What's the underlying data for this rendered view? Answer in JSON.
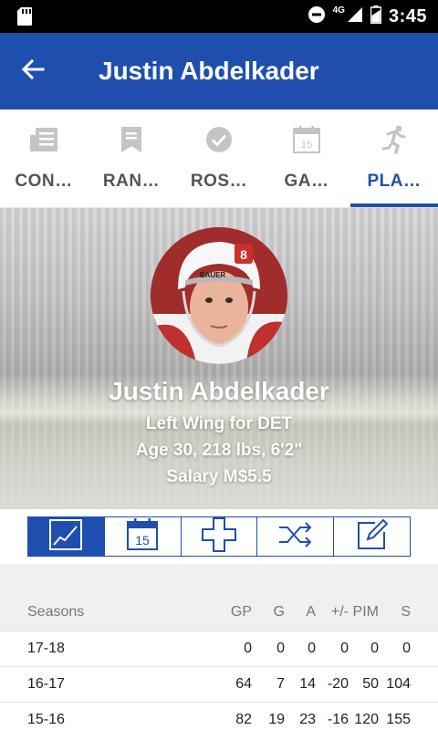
{
  "status_bar": {
    "network": "4G",
    "time": "3:45"
  },
  "app_bar": {
    "title": "Justin Abdelkader",
    "back_icon": "arrow-back-icon"
  },
  "tabs": [
    {
      "label": "CON…",
      "icon": "news-icon",
      "active": false
    },
    {
      "label": "RAN…",
      "icon": "bookmark-icon",
      "active": false
    },
    {
      "label": "ROS…",
      "icon": "check-circle-icon",
      "active": false
    },
    {
      "label": "GA…",
      "icon": "calendar-icon",
      "active": false
    },
    {
      "label": "PLA…",
      "icon": "runner-icon",
      "active": true
    }
  ],
  "calendar_day": "15",
  "player": {
    "name": "Justin Abdelkader",
    "position_team": "Left Wing for DET",
    "bio": "Age 30, 218 lbs, 6'2\"",
    "salary": "Salary M$5.5",
    "jersey_number": "8",
    "helmet_brand": "BAUER"
  },
  "view_toggle": [
    {
      "name": "chart",
      "icon": "line-chart-icon",
      "active": true
    },
    {
      "name": "schedule",
      "icon": "calendar-icon",
      "day": "15",
      "active": false
    },
    {
      "name": "health",
      "icon": "plus-icon",
      "active": false
    },
    {
      "name": "transactions",
      "icon": "shuffle-icon",
      "active": false
    },
    {
      "name": "notes",
      "icon": "edit-icon",
      "active": false
    }
  ],
  "stats": {
    "columns": [
      "Seasons",
      "GP",
      "G",
      "A",
      "+/-",
      "PIM",
      "S"
    ],
    "rows": [
      [
        "17-18",
        "0",
        "0",
        "0",
        "0",
        "0",
        "0"
      ],
      [
        "16-17",
        "64",
        "7",
        "14",
        "-20",
        "50",
        "104"
      ],
      [
        "15-16",
        "82",
        "19",
        "23",
        "-16",
        "120",
        "155"
      ]
    ]
  },
  "colors": {
    "primary": "#1f4fae",
    "status_bar": "#000000",
    "tab_inactive": "#555555",
    "header_bg": "#f0f0f0"
  }
}
